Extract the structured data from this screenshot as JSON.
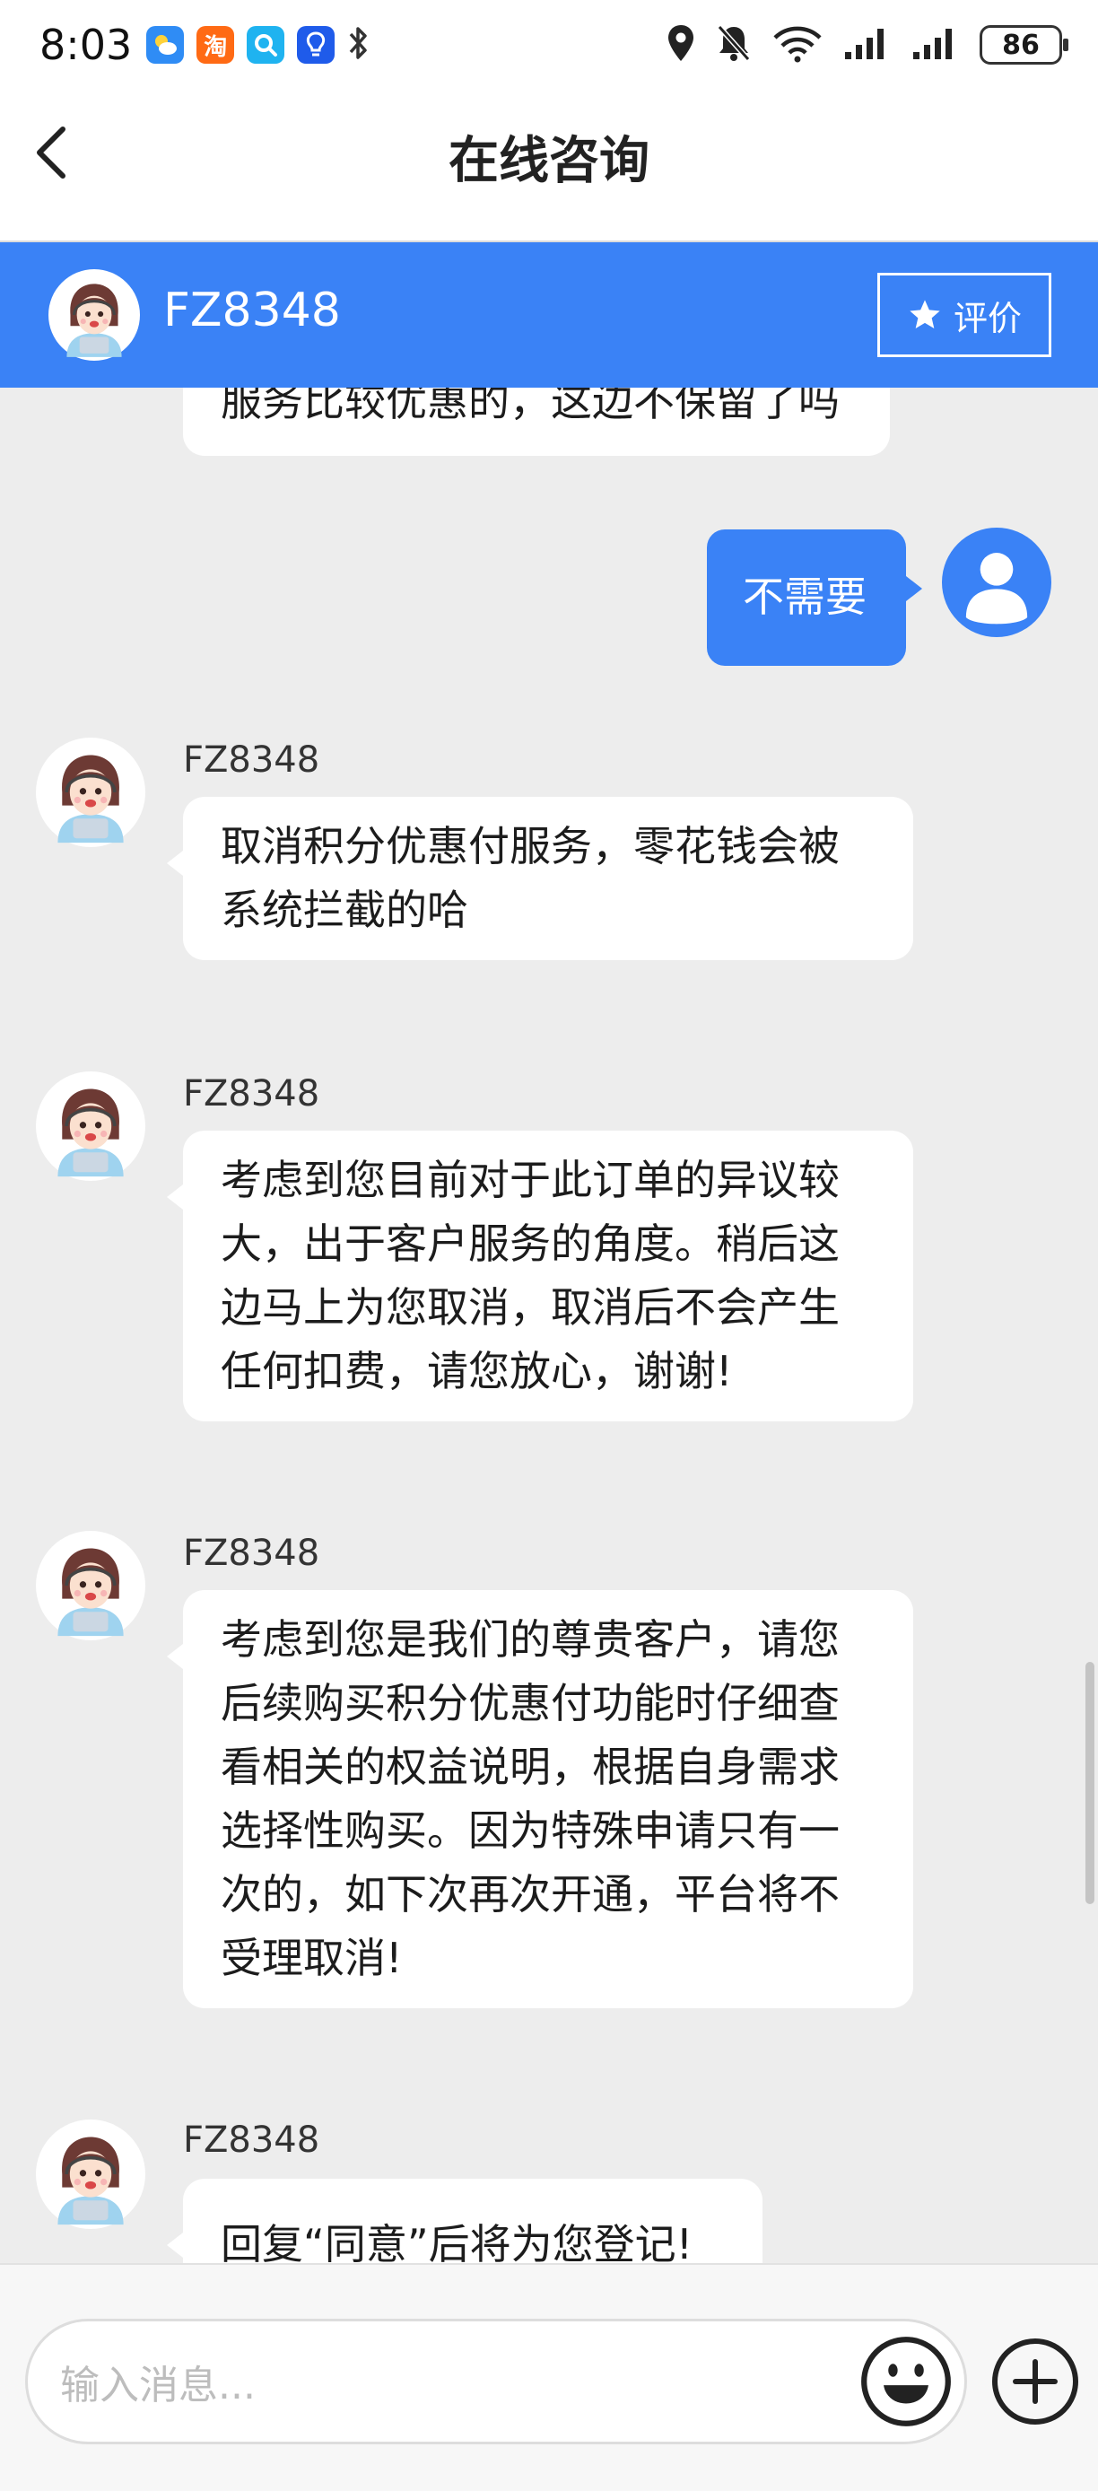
{
  "status_bar": {
    "time": "8:03",
    "battery": "86",
    "notification_icons": [
      "weather-app-icon",
      "taobao-app-icon",
      "search-app-icon",
      "bulb-app-icon",
      "bluetooth-icon"
    ],
    "taobao_glyph": "淘",
    "system_icons": [
      "location-icon",
      "mute-icon",
      "wifi-icon",
      "signal-icon",
      "signal-icon"
    ]
  },
  "title_bar": {
    "title": "在线咨询"
  },
  "agent_header": {
    "name": "FZ8348",
    "rate_label": "评价"
  },
  "colors": {
    "accent": "#3a82f6",
    "background": "#ededed",
    "bubble": "#ffffff"
  },
  "messages": [
    {
      "from": "agent",
      "text": "服务比较优惠的，这边不保留了吗"
    },
    {
      "from": "user",
      "text": "不需要"
    },
    {
      "from": "agent",
      "sender": "FZ8348",
      "lines": [
        "取消积分优惠付服务，零花钱会被",
        "系统拦截的哈"
      ]
    },
    {
      "from": "agent",
      "sender": "FZ8348",
      "lines": [
        "考虑到您目前对于此订单的异议较",
        "大，出于客户服务的角度。稍后这",
        "边马上为您取消，取消后不会产生",
        "任何扣费，请您放心，谢谢!"
      ]
    },
    {
      "from": "agent",
      "sender": "FZ8348",
      "lines": [
        "考虑到您是我们的尊贵客户，请您",
        "后续购买积分优惠付功能时仔细查",
        "看相关的权益说明，根据自身需求",
        "选择性购买。因为特殊申请只有一",
        "次的，如下次再次开通，平台将不",
        "受理取消!"
      ]
    },
    {
      "from": "agent",
      "sender": "FZ8348",
      "text": "回复“同意”后将为您登记!"
    }
  ],
  "input": {
    "placeholder": "输入消息..."
  }
}
